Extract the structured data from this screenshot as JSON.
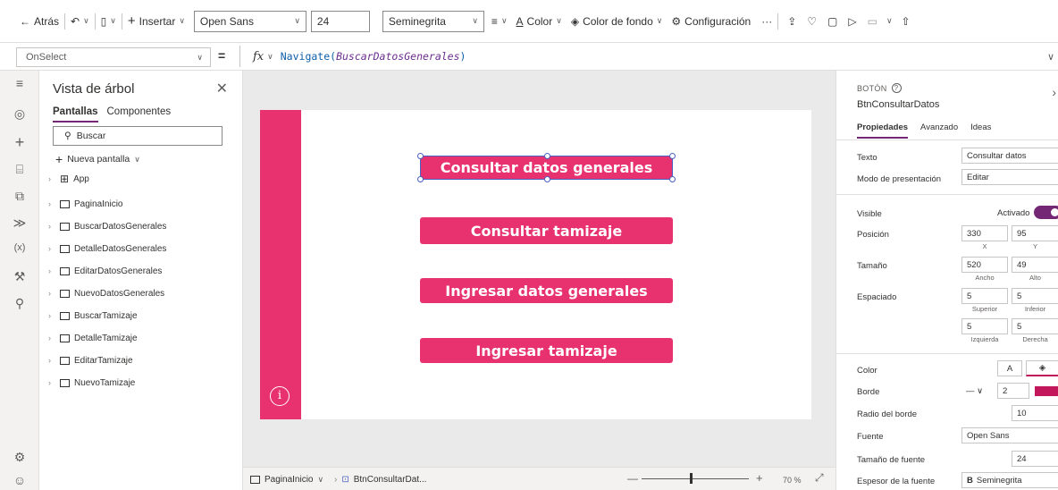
{
  "toolbar": {
    "back_label": "Atrás",
    "insert_label": "Insertar",
    "font_value": "Open Sans",
    "font_size_value": "24",
    "font_weight_value": "Seminegrita",
    "color_label": "Color",
    "fill_label": "Color de fondo",
    "settings_label": "Configuración",
    "more_label": "···"
  },
  "formula_bar": {
    "property": "OnSelect",
    "fx_label": "fx",
    "formula_fn": "Navigate(",
    "formula_arg": "BuscarDatosGenerales",
    "formula_end": ")"
  },
  "tree": {
    "title": "Vista de árbol",
    "tabs": [
      "Pantallas",
      "Componentes"
    ],
    "search_placeholder": "Buscar",
    "new_screen_label": "Nueva pantalla",
    "items": [
      "App",
      "PaginaInicio",
      "BuscarDatosGenerales",
      "DetalleDatosGenerales",
      "EditarDatosGenerales",
      "NuevoDatosGenerales",
      "BuscarTamizaje",
      "DetalleTamizaje",
      "EditarTamizaje",
      "NuevoTamizaje"
    ]
  },
  "canvas": {
    "buttons": [
      "Consultar datos generales",
      "Consultar tamizaje",
      "Ingresar datos generales",
      "Ingresar tamizaje"
    ],
    "accent_color": "#e8316f"
  },
  "bottom_bar": {
    "screen_crumb": "PaginaInicio",
    "control_crumb": "BtnConsultarDat...",
    "zoom": "70 %"
  },
  "properties": {
    "type_label": "BOTÓN",
    "control_name": "BtnConsultarDatos",
    "tabs": [
      "Propiedades",
      "Avanzado",
      "Ideas"
    ],
    "text_label": "Texto",
    "text_value": "Consultar datos",
    "mode_label": "Modo de presentación",
    "mode_value": "Editar",
    "visible_label": "Visible",
    "visible_value": "Activado",
    "position_label": "Posición",
    "pos_x": "330",
    "pos_y": "95",
    "x_label": "X",
    "y_label": "Y",
    "size_label": "Tamaño",
    "width": "520",
    "height": "49",
    "width_label": "Ancho",
    "height_label": "Alto",
    "padding_label": "Espaciado",
    "pad_top": "5",
    "pad_bottom": "5",
    "pad_left": "5",
    "pad_right": "5",
    "top_label": "Superior",
    "bottom_label": "Inferior",
    "left_label": "Izquierda",
    "right_label": "Derecha",
    "color_label": "Color",
    "color_text_sample": "A",
    "border_label": "Borde",
    "border_value": "2",
    "radius_label": "Radio del borde",
    "radius_value": "10",
    "font_label": "Fuente",
    "font_value": "Open Sans",
    "font_size_label": "Tamaño de fuente",
    "font_size_value": "24",
    "weight_label": "Espesor de la fuente",
    "weight_value": "Seminegrita",
    "weight_bold_glyph": "B",
    "brand_color": "#742774"
  }
}
